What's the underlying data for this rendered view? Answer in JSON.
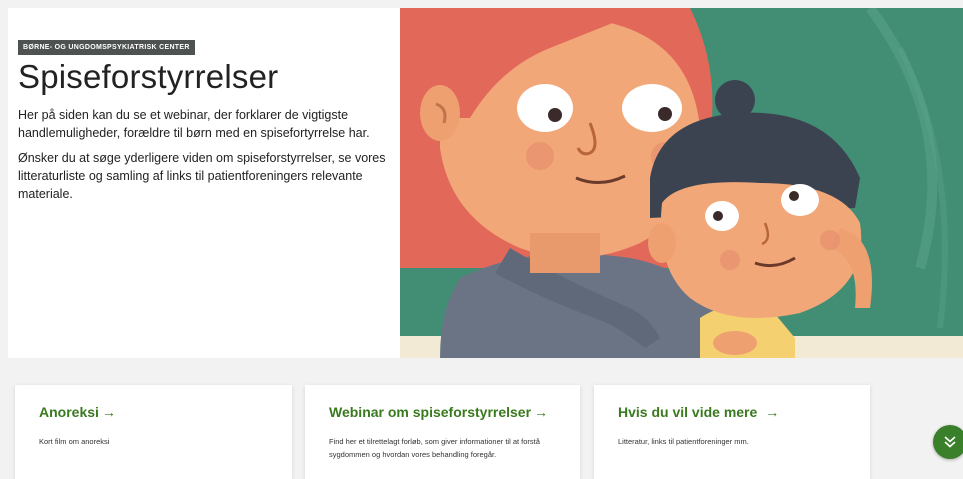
{
  "hero": {
    "eyebrow": "BØRNE- OG UNGDOMSPSYKIATRISK CENTER",
    "title": "Spiseforstyrrelser",
    "paragraph1": "Her på siden kan du se et webinar, der forklarer de vigtigste handlemuligheder, forældre til børn med en spisefortyrrelse har.",
    "paragraph2": "Ønsker du at søge yderligere viden om spiseforstyrrelser, se vores litteraturliste og samling af links til patientforeningers relevante materiale.",
    "image_icon": "illustration-mother-and-child"
  },
  "cards": [
    {
      "title": "Anoreksi",
      "arrow": "→",
      "description": "Kort film om anoreksi"
    },
    {
      "title": "Webinar om spiseforstyrrelser",
      "arrow": "→",
      "description": "Find her et tilrettelagt forløb, som giver informationer til at forstå sygdommen og hvordan vores behandling foregår."
    },
    {
      "title": "Hvis du vil vide mere",
      "arrow": "→",
      "description": "Litteratur, links til patientforeninger mm."
    }
  ],
  "scroll_button": {
    "icon": "double-chevron-down-icon"
  },
  "colors": {
    "accent_green": "#3a7a1f",
    "eyebrow_bg": "#4e5352",
    "illustration_bg": "#3d8a70"
  }
}
